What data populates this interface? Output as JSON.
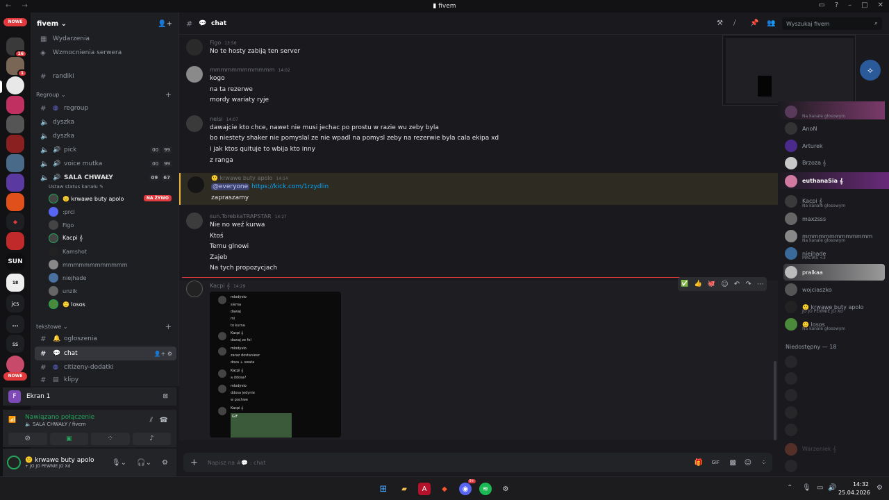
{
  "window": {
    "title": "fivem"
  },
  "guilds": {
    "new1": "NOWE",
    "new2": "NOWE",
    "badge_top": "2",
    "badge_16": "16",
    "badge_1": "1",
    "label_jcs": "jcs",
    "label_ss": "ss",
    "label_sun": "SUN",
    "label_more": "..."
  },
  "sidebar": {
    "server_name": "fivem ⌄",
    "top_items": [
      "Wydarzenia",
      "Wzmocnienia serwera"
    ],
    "randiki": "randiki",
    "cat_regroup": "Regroup ⌄",
    "cat_tekstowe": "tekstowe ⌄",
    "channels": {
      "regroup": "regroup",
      "dyszka1": "dyszka",
      "dyszka2": "dyszka",
      "pick": "pick",
      "voice_mutka": "voice mutka",
      "sala": "SALA CHWAŁY",
      "set_status": "Ustaw status kanału ✎",
      "ogloszenia": "ogloszenia",
      "chat": "chat",
      "citizeny": "citizeny-dodatki",
      "klipy": "klipy"
    },
    "counts": {
      "pick": [
        "00",
        "99"
      ],
      "voice_mutka": [
        "00",
        "99"
      ],
      "sala": [
        "09",
        "67"
      ]
    },
    "voice_users": [
      "🙂 krwawe buty apolo",
      ":prcl",
      "Figo",
      "Kacpi 𝄞",
      "Kamshot",
      "mmmmmmmmmmmm",
      "niejhade",
      "unzik",
      "🙂 losos"
    ],
    "live_badge": "NA ŻYWO"
  },
  "screen_share": {
    "icon_letter": "F",
    "label": "Ekran 1"
  },
  "voice_panel": {
    "status": "Nawiązano połączenie",
    "channel": "🔈 SALA CHWAŁY / fivem"
  },
  "user": {
    "name": "🙂 krwawe buty apolo",
    "status": "+ JO JO PEWNIE JO Xd"
  },
  "chat": {
    "channel_name": "chat",
    "search_placeholder": "Wyszukaj fivem",
    "messages": [
      {
        "author": "Figo",
        "time": "13:56",
        "lines": [
          "No te hosty zabiją ten server"
        ]
      },
      {
        "author": "mmmmmmmmmmmm",
        "time": "14:02",
        "lines": [
          "kogo",
          "na ta rezerwe",
          "mordy wariaty ryje"
        ]
      },
      {
        "author": "nelsi",
        "time": "14:07",
        "lines": [
          "dawajcie kto chce, nawet nie musi jechac po prostu w razie wu zeby byla",
          "bo niestety shaker nie pomyslal ze nie wpadl na pomysl zeby na rezerwie byla cala ekipa xd",
          "i jak ktos quituje to wbija kto inny",
          "z ranga"
        ]
      },
      {
        "author": "🙂 krwawe buty apolo",
        "time": "14:14",
        "mention": "@everyone",
        "link": "https://kick.com/1rzydlin",
        "lines": [
          "zapraszamy"
        ]
      },
      {
        "author": "sun.TorebkaTRAPSTAR",
        "time": "14:27",
        "lines": [
          "Nie no weź kurwa",
          "Ktoś",
          "Temu glnowi",
          "Zajeb",
          "Na tych propozycjach"
        ]
      },
      {
        "author": "Kacpi 𝄞",
        "time": "14:29",
        "lines": []
      }
    ],
    "embed_lines": [
      {
        "name": "mlodyvio",
        "text": [
          "siema",
          "dawaj",
          "mi",
          "to kurna"
        ]
      },
      {
        "name": "Kacpi 𝄞",
        "text": [
          "dawaj ze fel"
        ]
      },
      {
        "name": "mlodyvio",
        "text": [
          "zaraz dostaniesz",
          "doxa + swata"
        ]
      },
      {
        "name": "Kacpi 𝄞",
        "text": [
          "a ddosa?"
        ]
      },
      {
        "name": "mlodyvio",
        "text": [
          "ddosa jedynie",
          "w pochwe"
        ]
      },
      {
        "name": "Kacpi 𝄞",
        "text": [
          "GIF"
        ]
      }
    ],
    "input_placeholder": "Napisz na #💬 : chat"
  },
  "members": {
    "voice_sub": "Na kanale głosowym",
    "list": [
      {
        "name": "",
        "sub": "Na kanale głosowym"
      },
      {
        "name": "AnoN",
        "sub": ""
      },
      {
        "name": "Arturek",
        "sub": ""
      },
      {
        "name": "Brzoza 𝄞",
        "sub": ""
      },
      {
        "name": "euthanaSia 𝄞",
        "sub": ""
      },
      {
        "name": "Kacpi 𝄞",
        "sub": "Na kanale głosowym"
      },
      {
        "name": "maxzsss",
        "sub": ""
      },
      {
        "name": "mmmmmmmmmmmmm",
        "sub": "Na kanale głosowym"
      },
      {
        "name": "niejhade",
        "sub": "MACIAS <3"
      },
      {
        "name": "pralkaa",
        "sub": ""
      },
      {
        "name": "wojciaszko",
        "sub": ""
      },
      {
        "name": "🙂 krwawe buty apolo",
        "sub": "JO JO PEWNIE JO Xd"
      },
      {
        "name": "🙂 losos",
        "sub": "Na kanale głosowym"
      }
    ],
    "offline_header": "Niedostępny — 18",
    "offline_named": "Warzeniek 𝄞"
  },
  "taskbar": {
    "time": "14:32",
    "date": "25.04.2026",
    "discord_badge": "9+"
  },
  "colors": {
    "accent": "#5865f2",
    "online": "#23a55a",
    "live": "#e03a3e",
    "mention_bg": "#3a3a2a"
  }
}
